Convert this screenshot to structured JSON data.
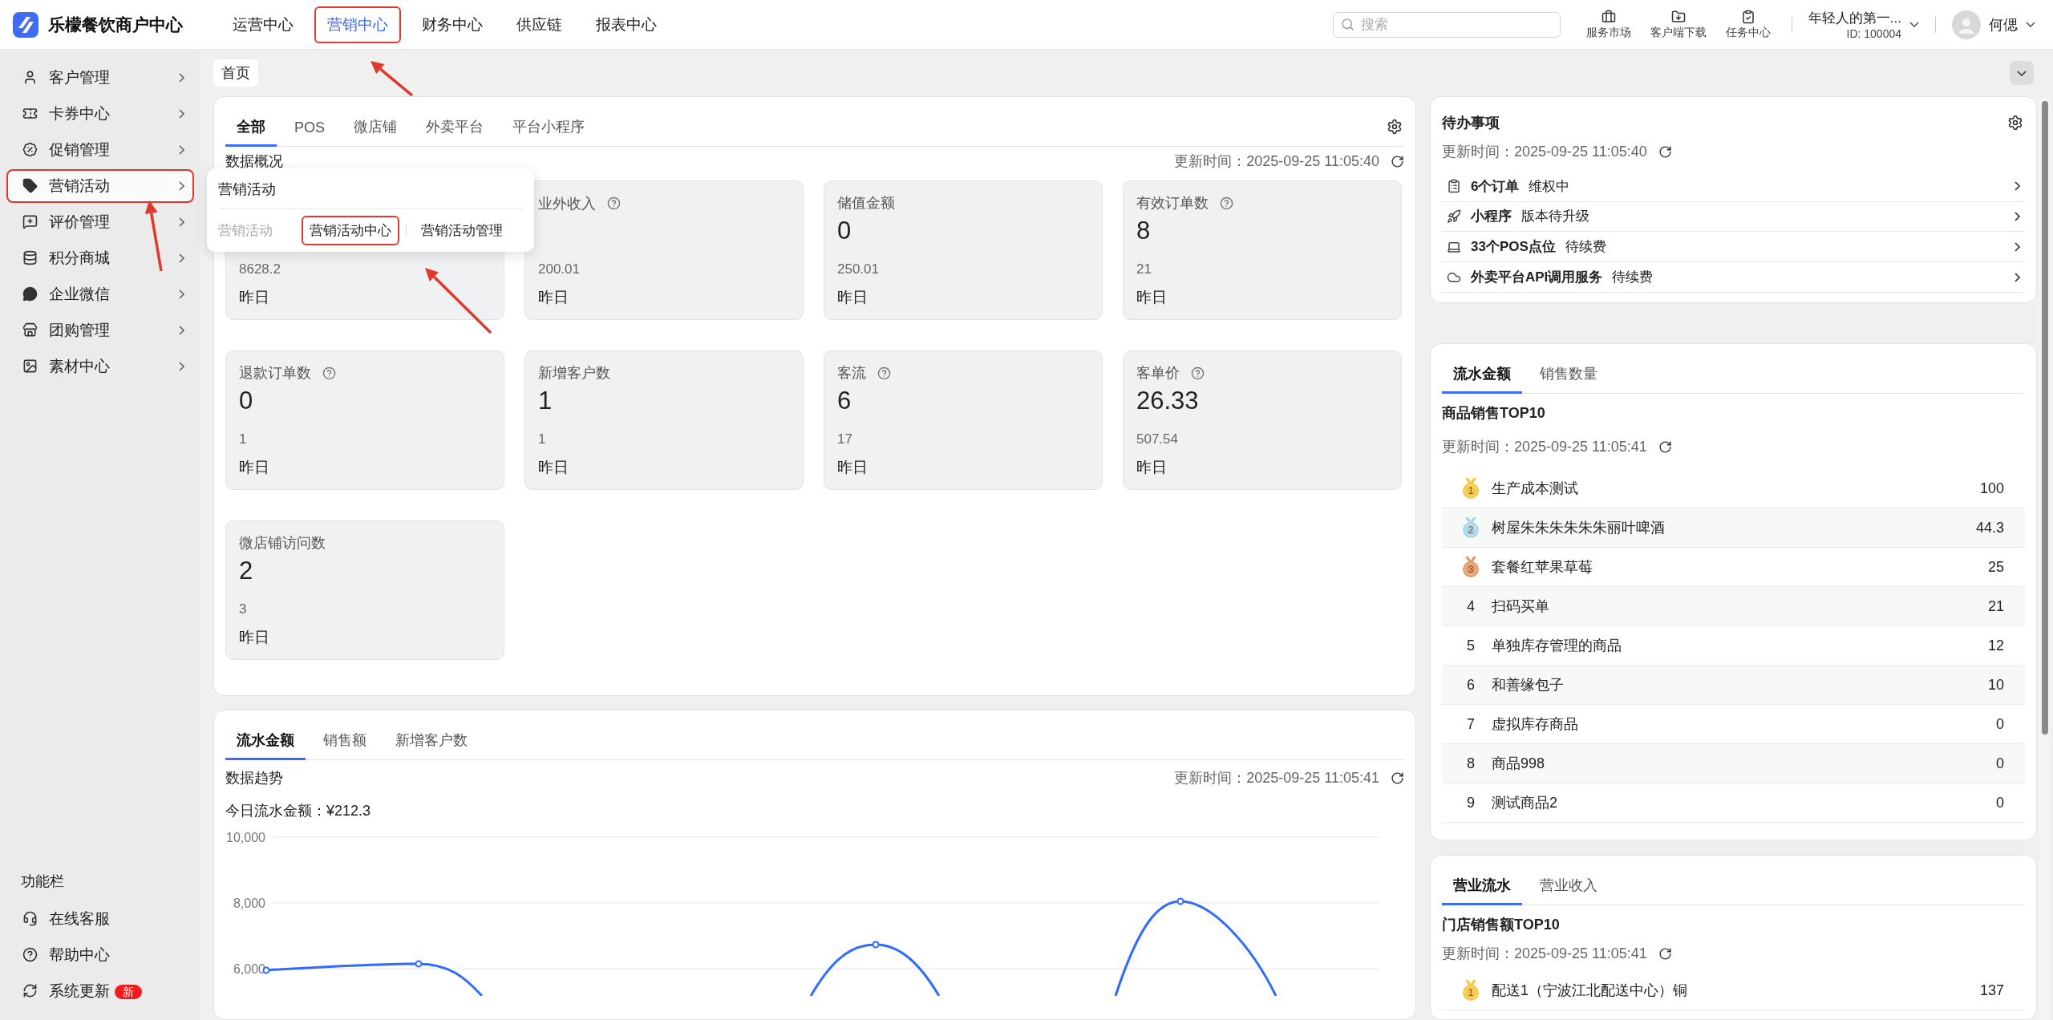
{
  "header": {
    "logo_text": "乐檬餐饮商户中心",
    "nav": [
      {
        "label": "运营中心",
        "selected": false,
        "highlighted": false
      },
      {
        "label": "营销中心",
        "selected": true,
        "highlighted": true
      },
      {
        "label": "财务中心",
        "selected": false,
        "highlighted": false
      },
      {
        "label": "供应链",
        "selected": false,
        "highlighted": false
      },
      {
        "label": "报表中心",
        "selected": false,
        "highlighted": false
      }
    ],
    "search": {
      "placeholder": "搜索"
    },
    "tools": [
      {
        "label": "服务市场"
      },
      {
        "label": "客户端下载"
      },
      {
        "label": "任务中心"
      }
    ],
    "account": {
      "name": "年轻人的第一...",
      "id": "ID: 100004"
    },
    "user": {
      "name": "何偲"
    }
  },
  "sidebar": {
    "items": [
      {
        "label": "客户管理",
        "selected": false,
        "highlighted": false
      },
      {
        "label": "卡券中心",
        "selected": false,
        "highlighted": false
      },
      {
        "label": "促销管理",
        "selected": false,
        "highlighted": false
      },
      {
        "label": "营销活动",
        "selected": true,
        "highlighted": true
      },
      {
        "label": "评价管理",
        "selected": false,
        "highlighted": false
      },
      {
        "label": "积分商城",
        "selected": false,
        "highlighted": false
      },
      {
        "label": "企业微信",
        "selected": false,
        "highlighted": false
      },
      {
        "label": "团购管理",
        "selected": false,
        "highlighted": false
      },
      {
        "label": "素材中心",
        "selected": false,
        "highlighted": false
      }
    ],
    "footer_title": "功能栏",
    "footer_items": [
      {
        "label": "在线客服"
      },
      {
        "label": "帮助中心"
      },
      {
        "label": "系统更新",
        "badge": "新"
      }
    ]
  },
  "breadcrumb": [
    {
      "label": "首页",
      "selected": true
    }
  ],
  "popup": {
    "title": "营销活动",
    "group_label": "营销活动",
    "links": [
      {
        "label": "营销活动中心",
        "highlighted": true
      },
      {
        "label": "营销活动管理",
        "highlighted": false
      }
    ]
  },
  "overview": {
    "tabs": [
      {
        "label": "全部",
        "selected": true
      },
      {
        "label": "POS",
        "selected": false
      },
      {
        "label": "微店铺",
        "selected": false
      },
      {
        "label": "外卖平台",
        "selected": false
      },
      {
        "label": "平台小程序",
        "selected": false
      }
    ],
    "title": "数据概况",
    "updated": "更新时间：2025-09-25 11:05:40",
    "cards": [
      {
        "compare": "8628.2",
        "period": "昨日"
      },
      {
        "title": "业外收入",
        "help": true,
        "compare": "200.01",
        "period": "昨日"
      },
      {
        "title": "储值金额",
        "help": false,
        "value": "0",
        "compare": "250.01",
        "period": "昨日"
      },
      {
        "title": "有效订单数",
        "help": true,
        "value": "8",
        "compare": "21",
        "period": "昨日"
      },
      {
        "title": "退款订单数",
        "help": true,
        "value": "0",
        "compare": "1",
        "period": "昨日"
      },
      {
        "title": "新增客户数",
        "help": false,
        "value": "1",
        "compare": "1",
        "period": "昨日"
      },
      {
        "title": "客流",
        "help": true,
        "value": "6",
        "compare": "17",
        "period": "昨日"
      },
      {
        "title": "客单价",
        "help": true,
        "value": "26.33",
        "compare": "507.54",
        "period": "昨日"
      },
      {
        "title": "微店铺访问数",
        "help": false,
        "value": "2",
        "compare": "3",
        "period": "昨日"
      }
    ]
  },
  "trend": {
    "tabs": [
      {
        "label": "流水金额",
        "selected": true
      },
      {
        "label": "销售额",
        "selected": false
      },
      {
        "label": "新增客户数",
        "selected": false
      }
    ],
    "title": "数据趋势",
    "updated": "更新时间：2025-09-25 11:05:41",
    "today": "今日流水金额：¥212.3",
    "y_axis_labels": [
      "10,000",
      "8,000",
      "6,000"
    ]
  },
  "todo": {
    "title": "待办事项",
    "updated": "更新时间：2025-09-25 11:05:40",
    "items": [
      {
        "title": "6个订单",
        "status": "维权中"
      },
      {
        "title": "小程序",
        "status": "版本待升级"
      },
      {
        "title": "33个POS点位",
        "status": "待续费"
      },
      {
        "title": "外卖平台API调用服务",
        "status": "待续费"
      }
    ]
  },
  "rank": {
    "tabs": [
      {
        "label": "流水金额",
        "selected": true
      },
      {
        "label": "销售数量",
        "selected": false
      }
    ],
    "title": "商品销售TOP10",
    "updated": "更新时间：2025-09-25 11:05:41",
    "rows": [
      {
        "kind": "medal",
        "color": "#f7c744",
        "rank": "1",
        "name": "生产成本测试",
        "value": "100"
      },
      {
        "kind": "medal",
        "color": "#a9d4ec",
        "rank": "2",
        "name": "树屋朱朱朱朱朱朱丽叶啤酒",
        "value": "44.3"
      },
      {
        "kind": "medal",
        "color": "#e59a6a",
        "rank": "3",
        "name": "套餐红苹果草莓",
        "value": "25"
      },
      {
        "kind": "plain",
        "rank": "4",
        "name": "扫码买单",
        "value": "21"
      },
      {
        "kind": "plain",
        "rank": "5",
        "name": "单独库存管理的商品",
        "value": "12"
      },
      {
        "kind": "plain",
        "rank": "6",
        "name": "和善缘包子",
        "value": "10"
      },
      {
        "kind": "plain",
        "rank": "7",
        "name": "虚拟库存商品",
        "value": "0"
      },
      {
        "kind": "plain",
        "rank": "8",
        "name": "商品998",
        "value": "0"
      },
      {
        "kind": "plain",
        "rank": "9",
        "name": "测试商品2",
        "value": "0"
      }
    ]
  },
  "store": {
    "tabs": [
      {
        "label": "营业流水",
        "selected": true
      },
      {
        "label": "营业收入",
        "selected": false
      }
    ],
    "title": "门店销售额TOP10",
    "updated": "更新时间：2025-09-25 11:05:41",
    "rows": [
      {
        "kind": "medal",
        "color": "#f7c744",
        "rank": "1",
        "name": "配送1（宁波江北配送中心）铜",
        "value": "137"
      }
    ]
  }
}
